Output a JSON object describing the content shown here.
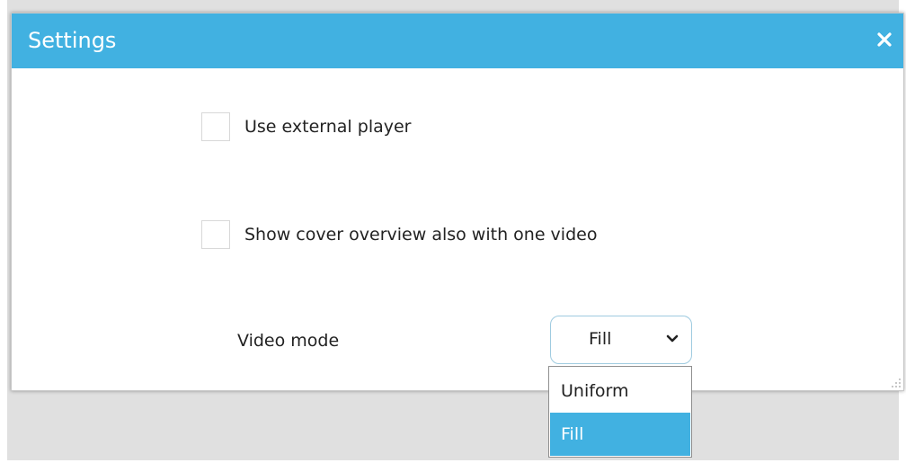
{
  "dialog": {
    "title": "Settings",
    "close_icon": "close-icon"
  },
  "options": {
    "use_external_player": {
      "label": "Use external player",
      "checked": false
    },
    "show_cover_overview": {
      "label": "Show cover overview also with one video",
      "checked": false
    }
  },
  "video_mode": {
    "label": "Video mode",
    "selected": "Fill",
    "chevron_icon": "chevron-down-icon",
    "dropdown_options": [
      "Uniform",
      "Fill"
    ],
    "highlighted_option": "Fill"
  },
  "colors": {
    "accent": "#41b1e1",
    "title_text": "#ffffff",
    "backdrop": "#e0e0e0"
  }
}
